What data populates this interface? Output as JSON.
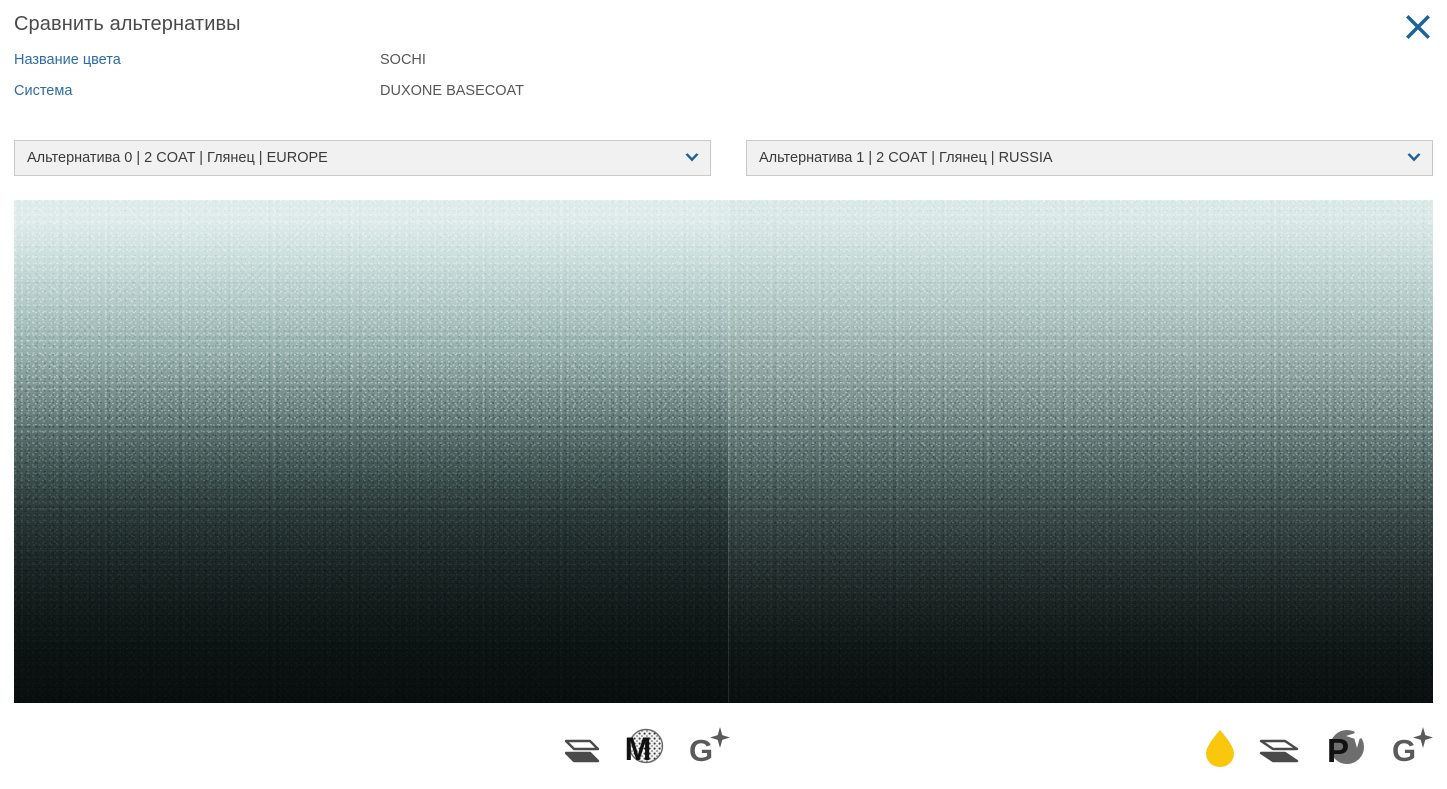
{
  "window": {
    "title": "Сравнить альтернативы",
    "close_label": "×",
    "close_icon": "close-x-icon",
    "close_color": "#1b6398"
  },
  "meta": {
    "rows": [
      {
        "label": "Название цвета",
        "value": "SOCHI"
      },
      {
        "label": "Система",
        "value": "DUXONE BASECOAT"
      }
    ],
    "label_color": "#2c6ca6",
    "value_color": "#575757"
  },
  "selectors": [
    {
      "name": "alternative-0-select",
      "value": "Альтернатива 0 | 2 COAT | Глянец | EUROPE",
      "caret_icon": "chevron-down-icon"
    },
    {
      "name": "alternative-1-select",
      "value": "Альтернатива 1 | 2 COAT | Глянец | RUSSIA",
      "caret_icon": "chevron-down-icon"
    }
  ],
  "swatches": [
    {
      "name": "alternative-0-swatch",
      "top_color": "#dfeceb",
      "mid_color": "#4c615f",
      "bottom_color": "#080d0d"
    },
    {
      "name": "alternative-1-swatch",
      "top_color": "#dbe9e7",
      "mid_color": "#5c716f",
      "bottom_color": "#090e0e"
    }
  ],
  "icon_legend": {
    "left": [
      {
        "icon": "layers-two-coat-icon",
        "label": ""
      },
      {
        "icon": "metallic-m-icon",
        "label": "M"
      },
      {
        "icon": "gloss-g-sparkle-icon",
        "label": "G"
      }
    ],
    "right": [
      {
        "icon": "droplet-icon",
        "label": "",
        "color": "#fac70c"
      },
      {
        "icon": "layers-two-coat-icon",
        "label": ""
      },
      {
        "icon": "pearl-p-sparkle-icon",
        "label": "P"
      },
      {
        "icon": "gloss-g-sparkle-icon",
        "label": "G"
      }
    ]
  }
}
